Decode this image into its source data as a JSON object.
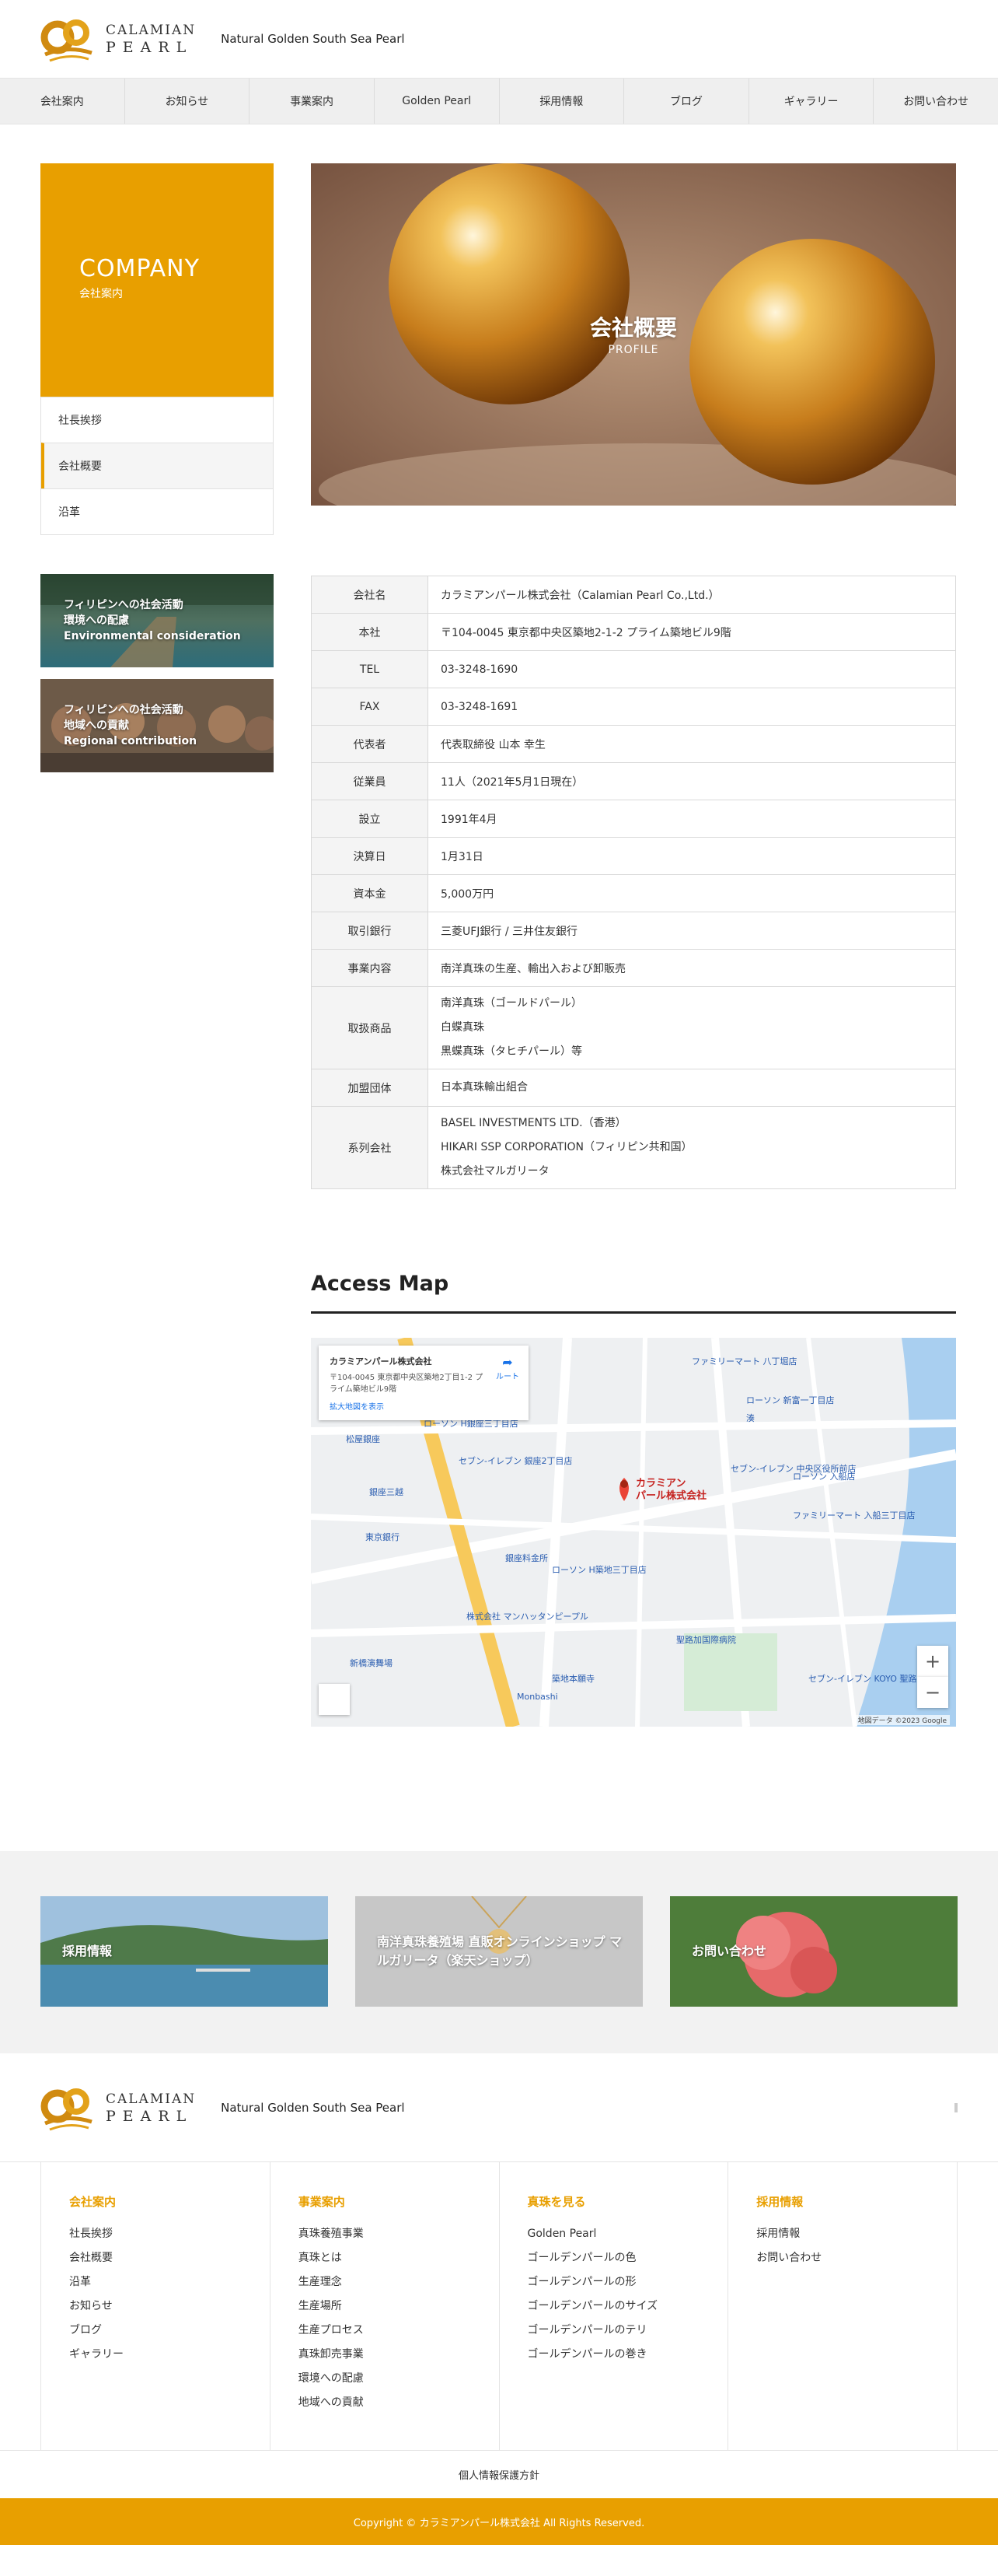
{
  "header": {
    "logo_line1": "CALAMIAN",
    "logo_line2": "PEARL",
    "tagline": "Natural Golden South Sea Pearl"
  },
  "nav": [
    "会社案内",
    "お知らせ",
    "事業案内",
    "Golden Pearl",
    "採用情報",
    "ブログ",
    "ギャラリー",
    "お問い合わせ"
  ],
  "side": {
    "title_en": "COMPANY",
    "title_jp": "会社案内",
    "menu": [
      "社長挨拶",
      "会社概要",
      "沿革"
    ],
    "active_menu": "会社概要",
    "banners": [
      {
        "line1": "フィリピンへの社会活動",
        "line2": "環境への配慮",
        "line3": "Environmental consideration"
      },
      {
        "line1": "フィリピンへの社会活動",
        "line2": "地域への貢献",
        "line3": "Regional contribution"
      }
    ]
  },
  "hero": {
    "title": "会社概要",
    "subtitle": "PROFILE"
  },
  "profile": [
    {
      "label": "会社名",
      "value": "カラミアンパール株式会社（Calamian Pearl Co.,Ltd.）"
    },
    {
      "label": "本社",
      "value": "〒104-0045 東京都中央区築地2-1-2 プライム築地ビル9階"
    },
    {
      "label": "TEL",
      "value": "03-3248-1690"
    },
    {
      "label": "FAX",
      "value": "03-3248-1691"
    },
    {
      "label": "代表者",
      "value": "代表取締役 山本 幸生"
    },
    {
      "label": "従業員",
      "value": "11人（2021年5月1日現在）"
    },
    {
      "label": "設立",
      "value": "1991年4月"
    },
    {
      "label": "決算日",
      "value": "1月31日"
    },
    {
      "label": "資本金",
      "value": "5,000万円"
    },
    {
      "label": "取引銀行",
      "value": "三菱UFJ銀行 / 三井住友銀行"
    },
    {
      "label": "事業内容",
      "value": "南洋真珠の生産、輸出入および卸販売"
    }
  ],
  "profile_multi": [
    {
      "label": "取扱商品",
      "values": [
        "南洋真珠（ゴールドパール）",
        "白蝶真珠",
        "黒蝶真珠（タヒチパール）等"
      ]
    },
    {
      "label": "加盟団体",
      "values": [
        "日本真珠輸出組合"
      ]
    },
    {
      "label": "系列会社",
      "values": [
        "BASEL INVESTMENTS LTD.（香港）",
        "HIKARI SSP CORPORATION（フィリピン共和国）",
        "株式会社マルガリータ"
      ]
    }
  ],
  "access": {
    "title": "Access Map",
    "card_line1": "カラミアンパール株式会社",
    "card_line2": "〒104-0045 東京都中央区築地2丁目1-2 プライム築地ビル9階",
    "card_link": "拡大地図を表示",
    "route": "ルート",
    "pin_label1": "カラミアン",
    "pin_label2": "パール株式会社",
    "map_labels": [
      "ファミリーマート 八丁堀店",
      "ローソン 新富一丁目店",
      "セブン-イレブン 中央区役所前店",
      "セブン-イレブン 銀座2丁目店",
      "ローソン H銀座三丁目店",
      "松屋銀座",
      "銀座三越",
      "東京銀行",
      "銀座料金所",
      "ローソン H築地三丁目店",
      "ファミリーマート 入船三丁目店",
      "聖路加国際病院",
      "セブン-イレブン KOYO 聖路加タワー店",
      "築地本願寺",
      "新橋演舞場",
      "Monbashi",
      "株式会社 マンハッタンピープル",
      "ローソン 入船店",
      "湊"
    ],
    "copyright": "地図データ ©2023 Google",
    "zoom_in": "+",
    "zoom_out": "−"
  },
  "band": [
    {
      "label": "採用情報"
    },
    {
      "label": "南洋真珠養殖場 直販オンラインショップ マルガリータ（楽天ショップ）"
    },
    {
      "label": "お問い合わせ"
    }
  ],
  "footer": {
    "columns": [
      {
        "head": "会社案内",
        "links": [
          "社長挨拶",
          "会社概要",
          "沿革",
          "お知らせ",
          "ブログ",
          "ギャラリー"
        ]
      },
      {
        "head": "事業案内",
        "links": [
          "真珠養殖事業",
          "真珠とは",
          "生産理念",
          "生産場所",
          "生産プロセス",
          "真珠卸売事業",
          "環境への配慮",
          "地域への貢献"
        ]
      },
      {
        "head": "真珠を見る",
        "links": [
          "Golden Pearl",
          "ゴールデンパールの色",
          "ゴールデンパールの形",
          "ゴールデンパールのサイズ",
          "ゴールデンパールのテリ",
          "ゴールデンパールの巻き"
        ]
      },
      {
        "head": "採用情報",
        "links": [
          "採用情報",
          "お問い合わせ"
        ]
      }
    ],
    "privacy": "個人情報保護方針",
    "copyright": "Copyright © カラミアンパール株式会社 All Rights Reserved."
  },
  "colors": {
    "accent": "#e89f00",
    "nav_bg": "#efefef"
  }
}
